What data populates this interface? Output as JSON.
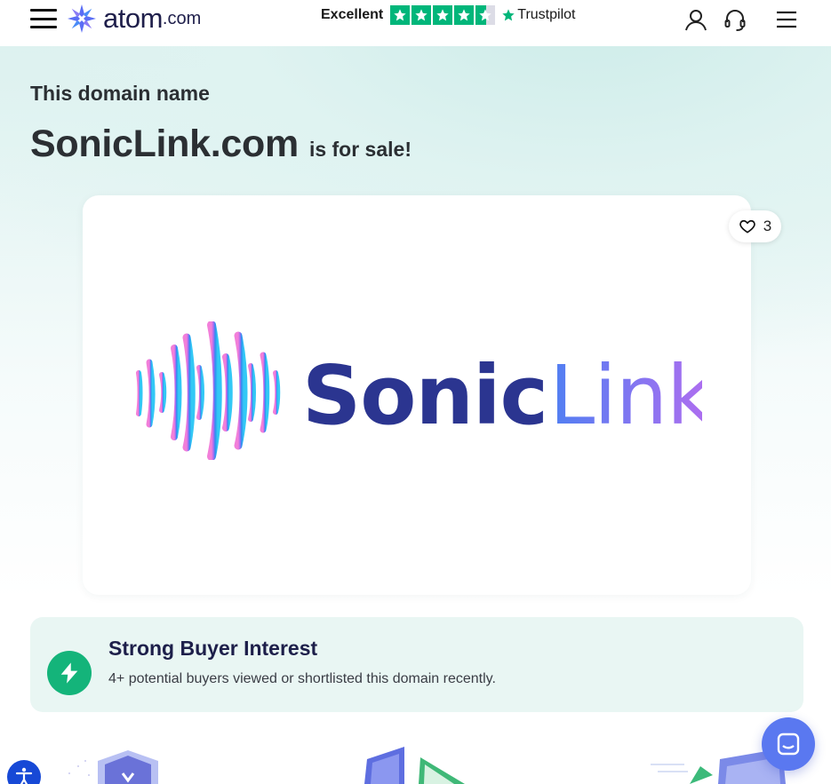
{
  "header": {
    "logo_word": "atom",
    "logo_tld": ".com",
    "trustpilot": {
      "rating_text": "Excellent",
      "stars": 4.5,
      "brand": "Trustpilot",
      "star_color": "#00b67a"
    },
    "icons": [
      "menu-icon",
      "user-icon",
      "headset-icon",
      "hamburger-menu-icon"
    ]
  },
  "hero": {
    "subtitle": "This domain name",
    "domain": "SonicLink.com",
    "for_sale": "is for sale!"
  },
  "card": {
    "favorites_count": "3",
    "logo_text_part1": "Sonic",
    "logo_text_part2": "Link"
  },
  "interest": {
    "title": "Strong Buyer Interest",
    "description": "4+ potential buyers viewed or shortlisted this domain recently.",
    "accent": "#14b47a"
  },
  "colors": {
    "brand_navy": "#1f1f4b",
    "chat_button": "#5a78f0",
    "accessibility_button": "#1749d6"
  }
}
